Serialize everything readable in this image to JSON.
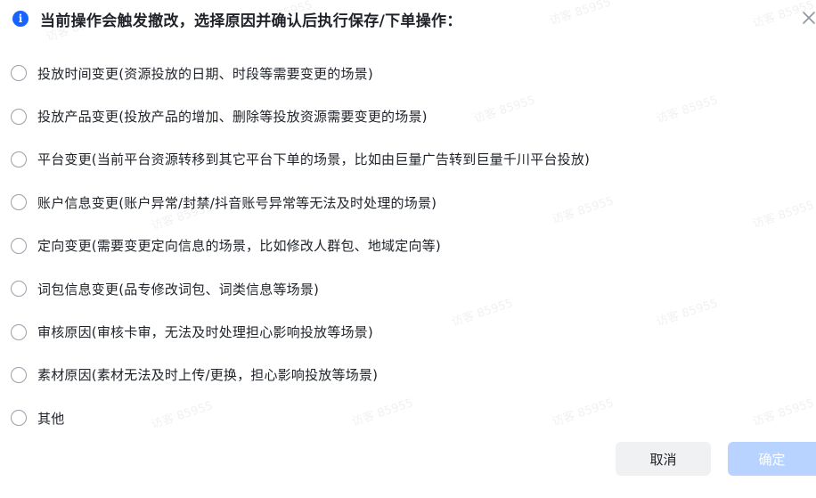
{
  "dialog": {
    "title": "当前操作会触发撤改，选择原因并确认后执行保存/下单操作：",
    "info_icon_glyph": "i",
    "options": [
      {
        "label": "投放时间变更(资源投放的日期、时段等需要变更的场景)",
        "selected": false
      },
      {
        "label": "投放产品变更(投放产品的增加、删除等投放资源需要变更的场景)",
        "selected": false
      },
      {
        "label": "平台变更(当前平台资源转移到其它平台下单的场景，比如由巨量广告转到巨量千川平台投放)",
        "selected": false
      },
      {
        "label": "账户信息变更(账户异常/封禁/抖音账号异常等无法及时处理的场景)",
        "selected": false
      },
      {
        "label": "定向变更(需要变更定向信息的场景，比如修改人群包、地域定向等)",
        "selected": false
      },
      {
        "label": "词包信息变更(品专修改词包、词类信息等场景)",
        "selected": false
      },
      {
        "label": "审核原因(审核卡审，无法及时处理担心影响投放等场景)",
        "selected": false
      },
      {
        "label": "素材原因(素材无法及时上传/更换，担心影响投放等场景)",
        "selected": false
      },
      {
        "label": "其他",
        "selected": false
      }
    ],
    "cancel_label": "取消",
    "confirm_label": "确定",
    "confirm_disabled": true
  },
  "watermark": {
    "text": "访客 85955"
  },
  "colors": {
    "info_icon": "#1664ff",
    "confirm_disabled_bg": "#b8d3ff",
    "cancel_bg": "#f0f1f3",
    "text_primary": "#1f2329",
    "radio_border": "#9aa0a8",
    "close_icon": "#8f959e"
  }
}
